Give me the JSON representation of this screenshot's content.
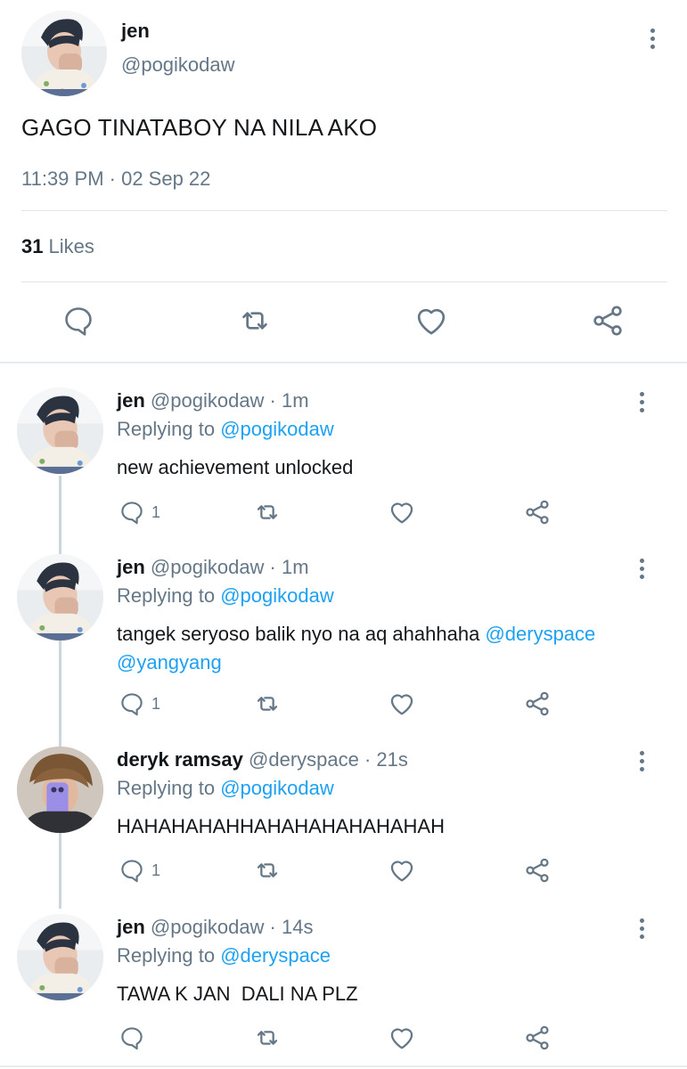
{
  "main_tweet": {
    "name": "jen",
    "handle": "@pogikodaw",
    "text": "GAGO TINATABOY NA NILA AKO",
    "timestamp": "11:39 PM · 02 Sep 22",
    "likes_count": "31",
    "likes_label": "Likes",
    "actions": [
      "reply-icon",
      "retweet-icon",
      "like-icon",
      "share-icon"
    ]
  },
  "replies": [
    {
      "name": "jen",
      "handle": "@pogikodaw · 1m",
      "replying_prefix": "Replying to",
      "replying_to": "@pogikodaw",
      "text": "new achievement unlocked",
      "mention1": "",
      "mention2": "",
      "reply_count": "1"
    },
    {
      "name": "jen",
      "handle": "@pogikodaw · 1m",
      "replying_prefix": "Replying to",
      "replying_to": "@pogikodaw",
      "text": "tangek seryoso balik nyo na aq ahahhaha",
      "mention1": "@deryspace",
      "mention2": "@yangyang",
      "reply_count": "1"
    },
    {
      "name": "deryk ramsay",
      "handle": "@deryspace · 21s",
      "replying_prefix": "Replying to",
      "replying_to": "@pogikodaw",
      "text": "HAHAHAHAHHAHAHAHAHAHAHAH",
      "mention1": "",
      "mention2": "",
      "reply_count": "1"
    },
    {
      "name": "jen",
      "handle": "@pogikodaw · 14s",
      "replying_prefix": "Replying to",
      "replying_to": "@deryspace",
      "text": "TAWA K JAN  DALI NA PLZ",
      "mention1": "",
      "mention2": "",
      "reply_count": ""
    }
  ],
  "colors": {
    "text": "#14171a",
    "muted": "#657786",
    "link": "#1da1f2",
    "divider": "#e1e8ed"
  }
}
